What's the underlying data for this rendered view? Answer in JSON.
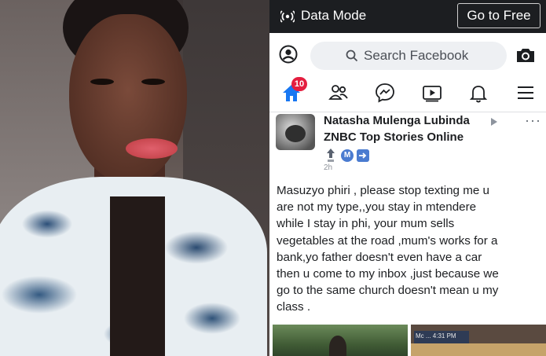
{
  "topbar": {
    "data_mode_label": "Data Mode",
    "go_free_label": "Go to Free",
    "background_color": "#1c1e21"
  },
  "search": {
    "placeholder": "Search Facebook",
    "icon": "search-icon"
  },
  "nav": {
    "home_badge": "10",
    "items": [
      "home-icon",
      "friends-icon",
      "messenger-icon",
      "watch-icon",
      "notifications-icon",
      "menu-icon"
    ],
    "accent_color": "#1877f2",
    "badge_color": "#e41e3f"
  },
  "post": {
    "author": "Natasha Mulenga Lubinda",
    "page": "ZNBC Top Stories Online",
    "badge_letter": "M",
    "time": "2h",
    "more": "···",
    "lines": [
      "Masuzyo phiri , please stop texting me u",
      "are not my type,,you stay in mtendere",
      "while I stay in phi, your mum sells",
      "vegetables at the road ,mum's works for a",
      "bank,yo father doesn't even have a car",
      "then u come to my inbox ,just because we",
      "go to the same church doesn't mean u my",
      "class ."
    ]
  },
  "thumbnails": {
    "second_label": "Mc ... 4:31 PM"
  }
}
